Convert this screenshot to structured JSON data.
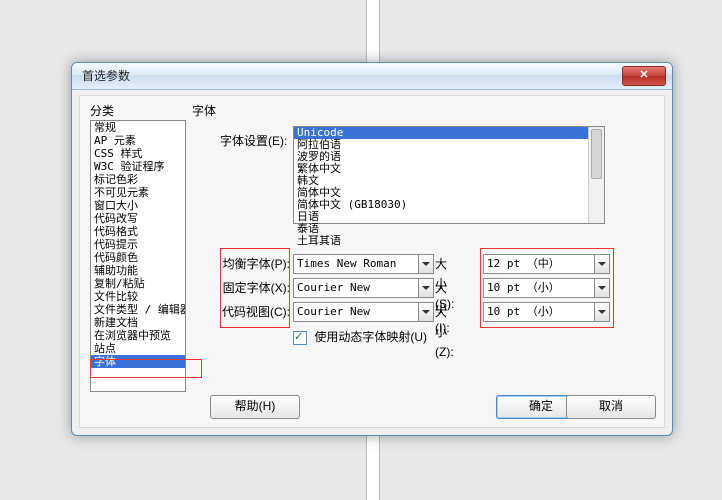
{
  "dialog": {
    "title": "首选参数",
    "close_glyph": "✕"
  },
  "labels": {
    "category": "分类",
    "font": "字体",
    "font_settings": "字体设置(E):",
    "proportional": "均衡字体(P):",
    "fixed": "固定字体(X):",
    "code": "代码视图(C):",
    "size_s": "大小(S):",
    "size_i": "大小(I):",
    "size_z": "大小(Z):",
    "use_dynamic": "使用动态字体映射(U)"
  },
  "categories": [
    "常规",
    "AP 元素",
    "CSS 样式",
    "W3C 验证程序",
    "标记色彩",
    "不可见元素",
    "窗口大小",
    "代码改写",
    "代码格式",
    "代码提示",
    "代码颜色",
    "辅助功能",
    "复制/粘贴",
    "文件比较",
    "文件类型 / 编辑器",
    "新建文档",
    "在浏览器中预览",
    "站点",
    "字体"
  ],
  "category_selected_index": 18,
  "font_list": [
    "Unicode",
    "阿拉伯语",
    "波罗的语",
    "繁体中文",
    "韩文",
    "简体中文",
    "简体中文 (GB18030)",
    "日语",
    "泰语",
    "土耳其语"
  ],
  "font_list_selected_index": 0,
  "fonts": {
    "proportional": "Times New Roman",
    "fixed": "Courier New",
    "code": "Courier New",
    "size_s": "12 pt （中）",
    "size_i": "10 pt （小）",
    "size_z": "10 pt （小）"
  },
  "dynamic_checked": true,
  "buttons": {
    "help": "帮助(H)",
    "ok": "确定",
    "cancel": "取消"
  }
}
